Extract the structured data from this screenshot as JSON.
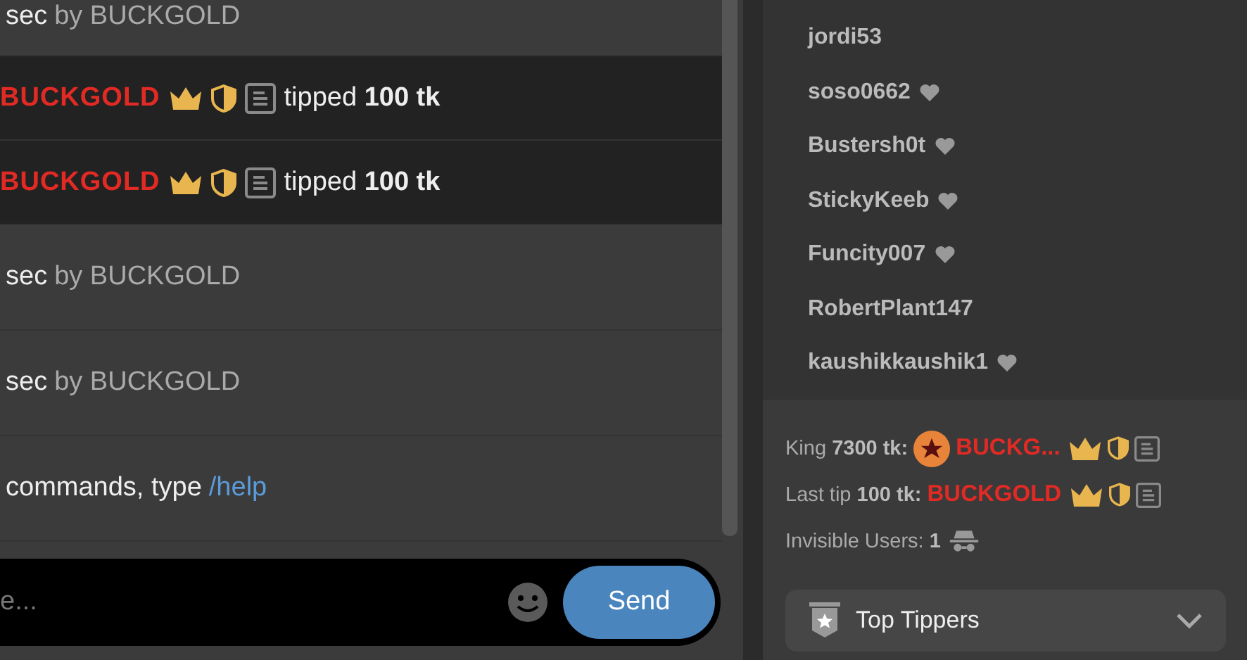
{
  "chat": {
    "messages": [
      {
        "kind": "status",
        "prefix": "sec",
        "text": "by BUCKGOLD"
      },
      {
        "kind": "tip",
        "user": "BUCKGOLD",
        "action": "tipped **100 tk**"
      },
      {
        "kind": "tip",
        "user": "BUCKGOLD",
        "action": "tipped **100 tk**"
      },
      {
        "kind": "status",
        "prefix": "sec",
        "text": "by BUCKGOLD"
      },
      {
        "kind": "status",
        "prefix": "sec",
        "text": "by BUCKGOLD"
      },
      {
        "kind": "notice",
        "text": "commands, type",
        "link": "/help"
      }
    ],
    "input": {
      "placeholder": "e..."
    },
    "send_button": "Send"
  },
  "users": [
    {
      "name": "jordi53",
      "fan": false
    },
    {
      "name": "soso0662",
      "fan": true
    },
    {
      "name": "Bustersh0t",
      "fan": true
    },
    {
      "name": "StickyKeeb",
      "fan": true
    },
    {
      "name": "Funcity007",
      "fan": true
    },
    {
      "name": "RobertPlant147",
      "fan": false
    },
    {
      "name": "kaushikkaushik1",
      "fan": true
    }
  ],
  "info": {
    "king": {
      "label": "King **7300 tk:**",
      "user": "BUCKG..."
    },
    "last_tip": {
      "label": "Last tip **100 tk:**",
      "user": "BUCKGOLD"
    },
    "invisible": {
      "label": "Invisible Users: **1**"
    }
  },
  "dropdown": {
    "label": "Top Tippers",
    "expanded": false
  }
}
